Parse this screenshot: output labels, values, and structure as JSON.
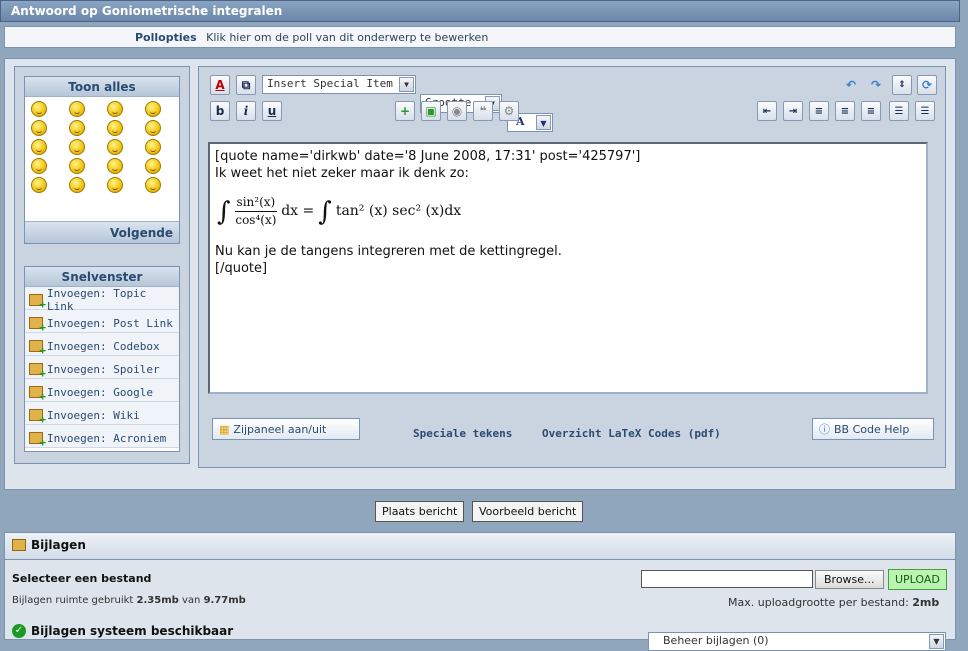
{
  "title": "Antwoord op Goniometrische integralen",
  "poll": {
    "label": "Pollopties",
    "text": "Klik hier om de poll van dit onderwerp te bewerken"
  },
  "smilies": {
    "header": "Toon alles",
    "next": "Volgende",
    "count": 20
  },
  "snelvenster": {
    "header": "Snelvenster",
    "items": [
      "Invoegen: Topic Link",
      "Invoegen: Post Link",
      "Invoegen: Codebox",
      "Invoegen: Spoiler",
      "Invoegen: Google",
      "Invoegen: Wiki",
      "Invoegen: Acroniem"
    ]
  },
  "toolbar": {
    "special_item": "Insert Special Item",
    "size": "Grootte",
    "font_color_letter": "A",
    "bold": "b",
    "italic": "i",
    "underline": "u",
    "font_letter": "a"
  },
  "editor": {
    "line1": "[quote name='dirkwb' date='8 June 2008, 17:31' post='425797']",
    "line2": "Ik weet het niet zeker maar ik denk zo:",
    "math_num": "sin²(x)",
    "math_den": "cos⁴(x)",
    "math_dx1": "dx =",
    "math_rhs": "tan² (x) sec² (x)dx",
    "line3": "Nu kan je de tangens integreren met de kettingregel.",
    "line4": "[/quote]"
  },
  "bottom_links": {
    "zijpaneel": "Zijpaneel aan/uit",
    "speciale": "Speciale tekens",
    "latex": "Overzicht LaTeX Codes (pdf)",
    "bbhelp": "BB Code Help"
  },
  "actions": {
    "post": "Plaats bericht",
    "preview": "Voorbeeld bericht"
  },
  "attachments": {
    "header": "Bijlagen",
    "manage": "Beheer bijlagen (0)",
    "select_label": "Selecteer een bestand",
    "browse": "Browse...",
    "upload": "UPLOAD",
    "space_prefix": "Bijlagen ruimte gebruikt",
    "space_used": "2.35mb",
    "space_of": "van",
    "space_total": "9.77mb",
    "max_prefix": "Max. uploadgrootte per bestand:",
    "max_size": "2mb",
    "system": "Bijlagen systeem beschikbaar"
  }
}
